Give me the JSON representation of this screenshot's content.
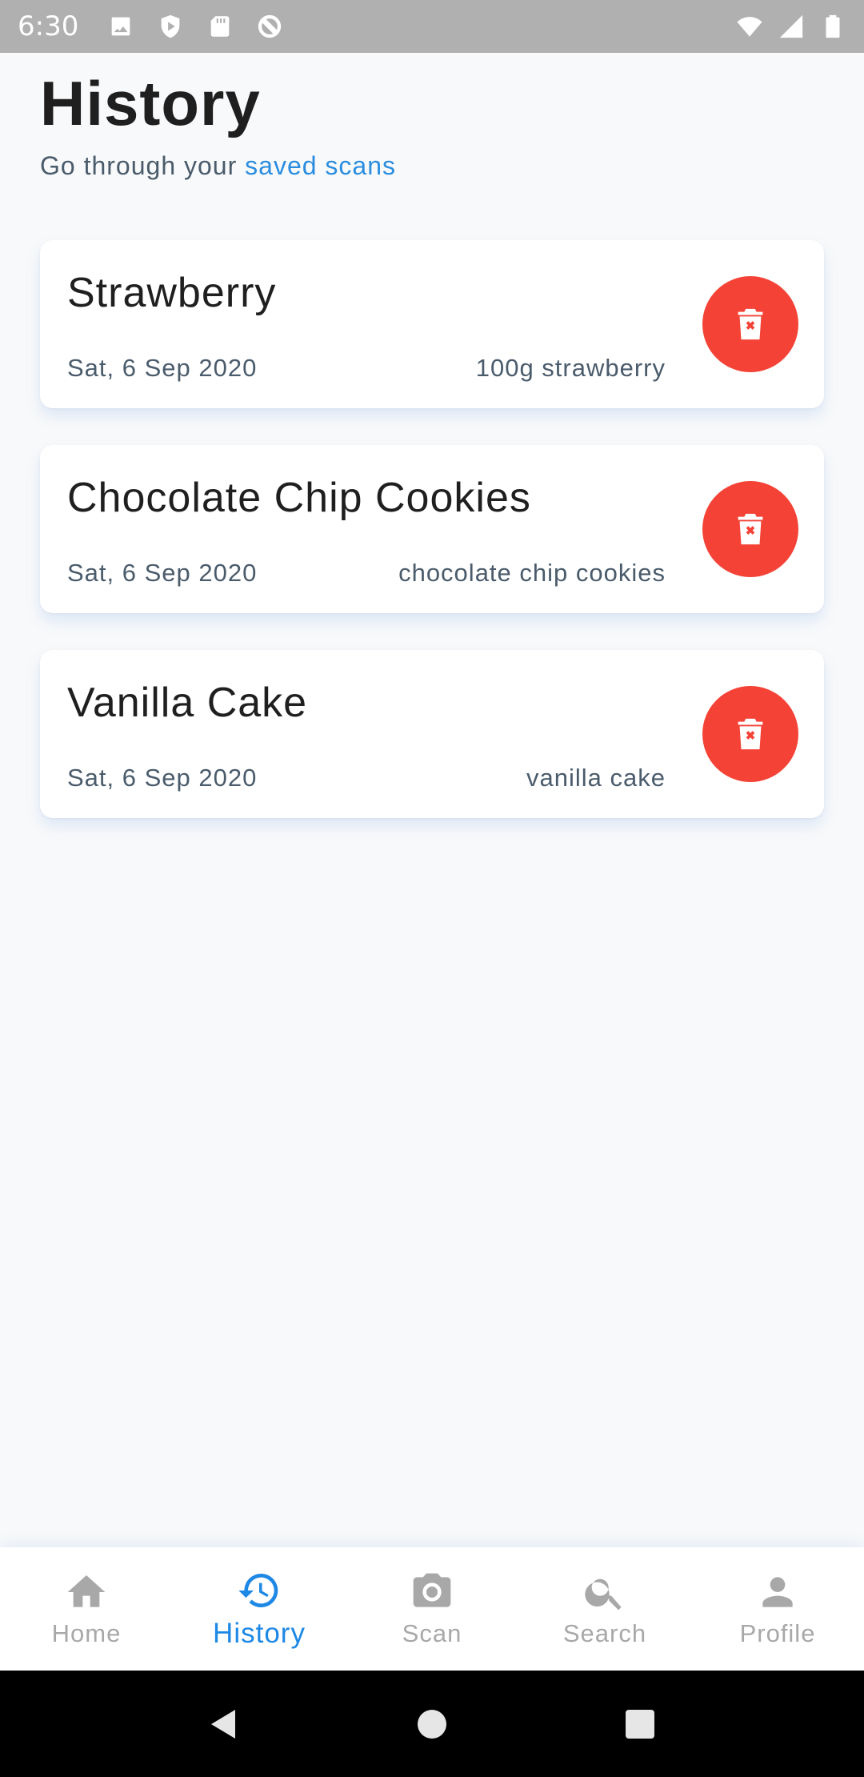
{
  "status_bar": {
    "time": "6:30",
    "left_icons": [
      "image-icon",
      "shield-icon",
      "sd-card-icon",
      "at-sign-icon"
    ],
    "right_icons": [
      "wifi-icon",
      "signal-icon",
      "battery-icon"
    ]
  },
  "header": {
    "title": "History",
    "subtitle_prefix": "Go through your",
    "subtitle_link": "saved scans"
  },
  "history": [
    {
      "title": "Strawberry",
      "date": "Sat, 6 Sep 2020",
      "description": "100g strawberry"
    },
    {
      "title": "Chocolate Chip Cookies",
      "date": "Sat, 6 Sep 2020",
      "description": "chocolate chip cookies"
    },
    {
      "title": "Vanilla Cake",
      "date": "Sat, 6 Sep 2020",
      "description": "vanilla cake"
    }
  ],
  "bottom_nav": [
    {
      "label": "Home",
      "icon": "home-icon",
      "active": false
    },
    {
      "label": "History",
      "icon": "history-icon",
      "active": true
    },
    {
      "label": "Scan",
      "icon": "camera-icon",
      "active": false
    },
    {
      "label": "Search",
      "icon": "search-icon",
      "active": false
    },
    {
      "label": "Profile",
      "icon": "person-icon",
      "active": false
    }
  ],
  "colors": {
    "accent": "#1e88e5",
    "link": "#2a8de0",
    "delete": "#f44336",
    "status_bar": "#b0b0b0"
  }
}
